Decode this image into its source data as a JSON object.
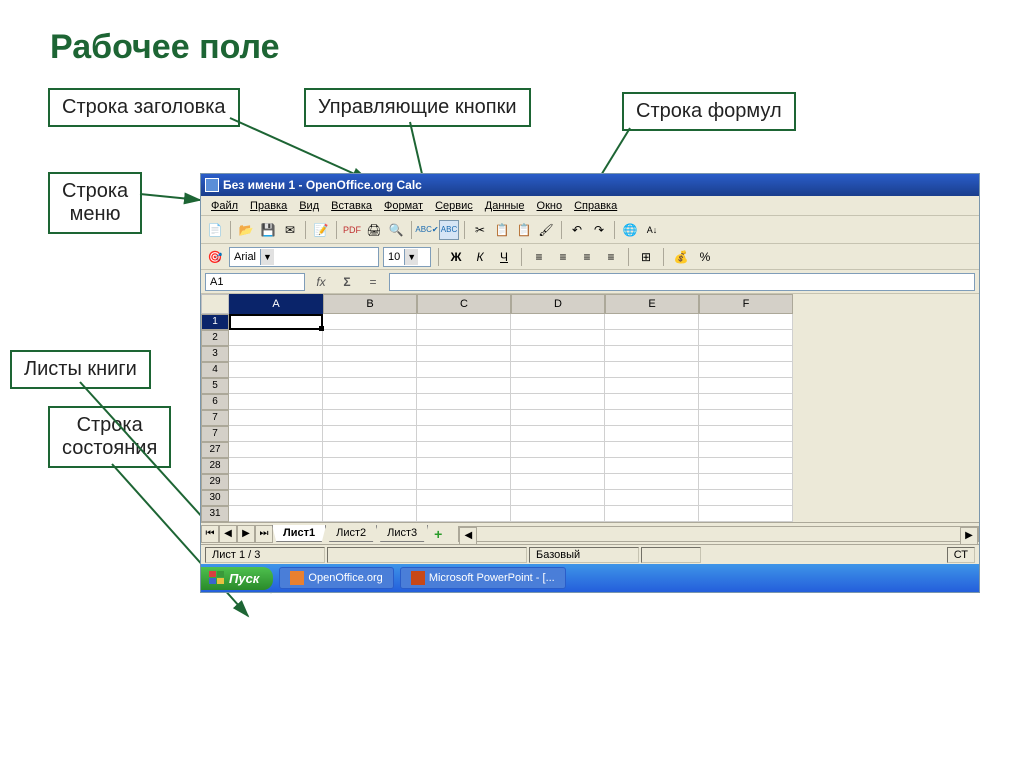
{
  "slide_title": "Рабочее поле",
  "callouts": {
    "title_row": "Строка заголовка",
    "control_buttons": "Управляющие кнопки",
    "formula_row": "Строка формул",
    "menu_row": "Строка\nменю",
    "sheets": "Листы книги",
    "status_row": "Строка\nсостояния"
  },
  "app": {
    "title": "Без имени 1 - OpenOffice.org Calc",
    "menu": [
      "Файл",
      "Правка",
      "Вид",
      "Вставка",
      "Формат",
      "Сервис",
      "Данные",
      "Окно",
      "Справка"
    ],
    "font_name": "Arial",
    "font_size": "10",
    "bold": "Ж",
    "italic": "К",
    "underline": "Ч",
    "namebox": "A1",
    "fx": "fx",
    "sigma": "Σ",
    "equals": "=",
    "columns": [
      "A",
      "B",
      "C",
      "D",
      "E",
      "F"
    ],
    "rows": [
      "1",
      "2",
      "3",
      "4",
      "5",
      "6",
      "7",
      "7",
      "27",
      "28",
      "29",
      "30",
      "31"
    ],
    "sheets": [
      "Лист1",
      "Лист2",
      "Лист3"
    ],
    "add_sheet": "+",
    "status_sheet": "Лист 1 / 3",
    "status_mode": "Базовый",
    "status_right": "СТ"
  },
  "taskbar": {
    "start": "Пуск",
    "task1": "OpenOffice.org",
    "task2": "Microsoft PowerPoint - [..."
  }
}
